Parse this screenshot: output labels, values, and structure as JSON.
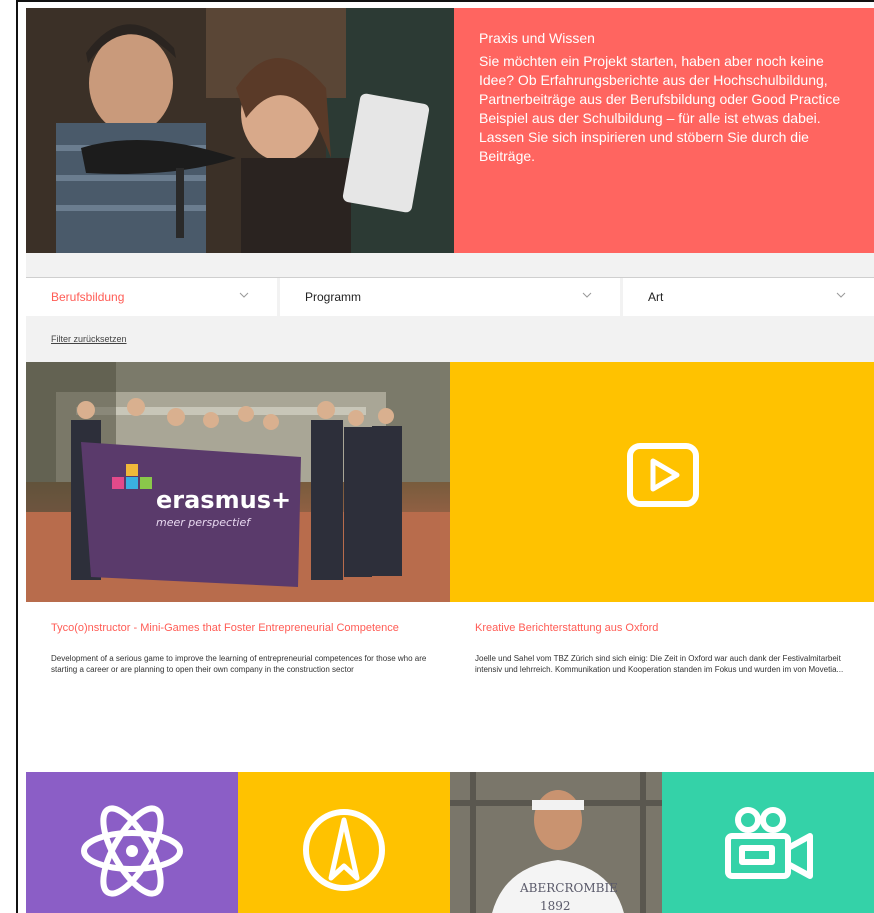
{
  "hero": {
    "title": "Praxis und Wissen",
    "body": "Sie möchten ein Projekt starten, haben aber noch keine Idee? Ob Erfahrungsberichte aus der Hochschulbildung, Partnerbeiträge aus der Berufsbildung oder Good Practice Beispiel aus der Schulbildung – für alle ist etwas dabei. Lassen Sie sich inspirieren und stöbern Sie durch die Beiträge."
  },
  "filters": {
    "items": [
      {
        "label": "Berufsbildung",
        "active": true
      },
      {
        "label": "Programm",
        "active": false
      },
      {
        "label": "Art",
        "active": false
      }
    ],
    "reset_label": "Filter zurücksetzen"
  },
  "cards": [
    {
      "title": "Tyco(o)nstructor - Mini-Games that Foster Entrepreneurial Competence",
      "description": "Development of a serious game to improve the learning of entrepreneurial competences for those who are starting a career or are planning to open their own company in the construction sector",
      "banner_text": "erasmus+",
      "banner_subtext": "meer perspectief"
    },
    {
      "title": "Kreative Berichterstattung aus Oxford",
      "description": "Joelle und Sahel vom TBZ Zürich sind sich einig: Die Zeit in Oxford war auch dank der Festivalmitarbeit intensiv und lehrreich. Kommunikation und Kooperation standen im Fokus und wurden im von Movetia...",
      "icon": "play-icon"
    }
  ],
  "tiles": [
    {
      "icon": "atom-icon",
      "color": "#8b5ec6"
    },
    {
      "icon": "compass-icon",
      "color": "#ffc200"
    },
    {
      "icon": "person-photo",
      "shirt_text": "ABERCROMBIE",
      "shirt_number": "1892"
    },
    {
      "icon": "video-camera-icon",
      "color": "#34d2a8"
    }
  ],
  "colors": {
    "accent": "#ff5c55",
    "hero_bg": "#ff6560",
    "yellow": "#ffc200",
    "purple": "#8b5ec6",
    "green": "#34d2a8"
  }
}
